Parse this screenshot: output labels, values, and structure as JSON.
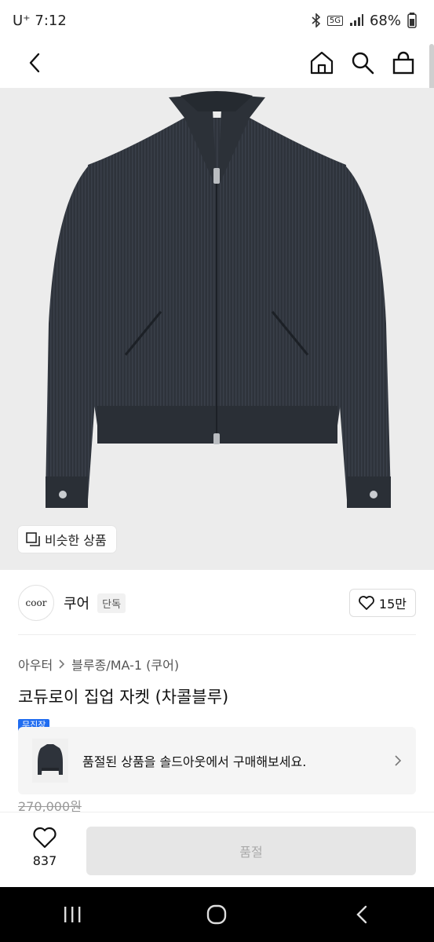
{
  "status": {
    "carrier": "U⁺ 7:12",
    "network": "5G",
    "battery": "68%"
  },
  "hero": {
    "similar_label": "비슷한 상품"
  },
  "brand": {
    "logo_text": "coor",
    "name": "쿠어",
    "badge": "단독",
    "likes": "15만"
  },
  "breadcrumb": {
    "category": "아우터",
    "subcategory": "블루종/MA-1 (쿠어)"
  },
  "product": {
    "title": "코듀로이 집업 자켓 (차콜블루)",
    "tag": "무진장",
    "price": "270,000원"
  },
  "soldout": {
    "message": "품절된 상품을 솔드아웃에서 구매해보세요."
  },
  "bottom": {
    "wish_count": "837",
    "buy_label": "품절"
  },
  "colors": {
    "jacket": "#2e333b",
    "tag_blue": "#1f6cf0",
    "hero_bg": "#ececec"
  }
}
